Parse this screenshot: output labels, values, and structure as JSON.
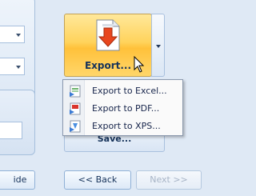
{
  "left_panel": {
    "side_button_label": "ide"
  },
  "export": {
    "label": "Export..."
  },
  "export_menu": {
    "items": [
      {
        "label": "Export to Excel...",
        "icon": "excel-icon"
      },
      {
        "label": "Export to PDF...",
        "icon": "pdf-icon"
      },
      {
        "label": "Export to XPS...",
        "icon": "xps-icon"
      }
    ]
  },
  "save": {
    "label": "Save..."
  },
  "nav": {
    "back_label": "<< Back",
    "next_label": "Next >>"
  },
  "colors": {
    "export_highlight": "#ffd35c",
    "background": "#dfe9f5"
  }
}
